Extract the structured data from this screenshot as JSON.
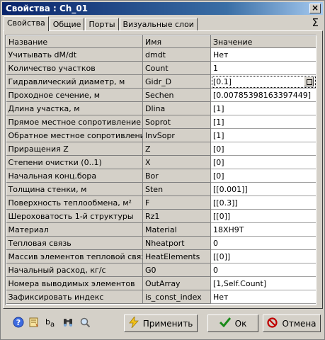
{
  "window": {
    "title": "Свойства :  Ch_01",
    "close_label": "×"
  },
  "tabs": [
    "Свойства",
    "Общие",
    "Порты",
    "Визуальные слои"
  ],
  "sigma_label": "Σ",
  "table": {
    "headers": [
      "Название",
      "Имя",
      "Значение"
    ],
    "rows": [
      {
        "name": "Учитывать dM/dt",
        "id": "dmdt",
        "value": "Нет"
      },
      {
        "name": "Количество участков",
        "id": "Count",
        "value": "1"
      },
      {
        "name": "Гидравлический диаметр, м",
        "id": "Gidr_D",
        "value": "[0.1]"
      },
      {
        "name": "Проходное сечение, м",
        "id": "Sechen",
        "value": "[0.00785398163397449]"
      },
      {
        "name": "Длина участка, м",
        "id": "Dlina",
        "value": "[1]"
      },
      {
        "name": "Прямое местное сопротивление",
        "id": "Soprot",
        "value": "[1]"
      },
      {
        "name": "Обратное местное сопротивление",
        "id": "InvSopr",
        "value": "[1]"
      },
      {
        "name": "Приращения Z",
        "id": "Z",
        "value": "[0]"
      },
      {
        "name": "Степени очистки (0..1)",
        "id": "X",
        "value": "[0]"
      },
      {
        "name": "Начальная конц.бора",
        "id": "Bor",
        "value": "[0]"
      },
      {
        "name": "Толщина стенки, м",
        "id": "Sten",
        "value": "[[0.001]]"
      },
      {
        "name": "Поверхность теплообмена, м²",
        "id": "F",
        "value": "[[0.3]]"
      },
      {
        "name": "Шероховатость 1-й структуры",
        "id": "Rz1",
        "value": "[[0]]"
      },
      {
        "name": "Материал",
        "id": "Material",
        "value": "18ХН9Т"
      },
      {
        "name": "Тепловая связь",
        "id": "Nheatport",
        "value": "0"
      },
      {
        "name": "Массив элементов тепловой связи",
        "id": "HeatElements",
        "value": "[[0]]"
      },
      {
        "name": "Начальный расход, кг/с",
        "id": "G0",
        "value": "0"
      },
      {
        "name": "Номера выводимых элементов",
        "id": "OutArray",
        "value": "[1,Self.Count]"
      },
      {
        "name": "Зафиксировать индекс",
        "id": "is_const_index",
        "value": "Нет"
      }
    ]
  },
  "toolbar_icons": [
    "help-icon",
    "notes-icon",
    "font-icon",
    "binoculars-icon",
    "magnifier-icon"
  ],
  "buttons": {
    "apply": "Применить",
    "ok": "Ок",
    "cancel": "Отмена"
  },
  "colors": {
    "title_start": "#0a246a",
    "title_end": "#a6caf0",
    "ok_check": "#1a8a1a",
    "cancel_icon": "#c00000"
  }
}
